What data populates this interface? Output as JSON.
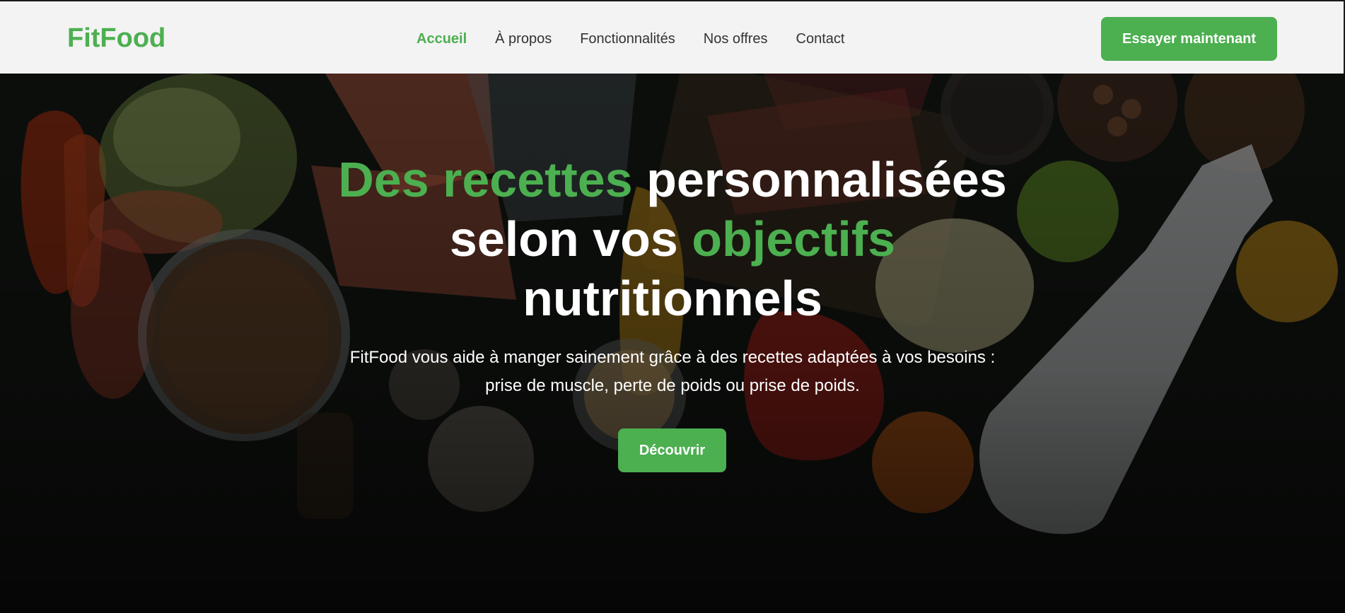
{
  "brand": {
    "name": "FitFood",
    "accent": "#4caf50"
  },
  "nav": {
    "items": [
      {
        "label": "Accueil",
        "active": true
      },
      {
        "label": "À propos",
        "active": false
      },
      {
        "label": "Fonctionnalités",
        "active": false
      },
      {
        "label": "Nos offres",
        "active": false
      },
      {
        "label": "Contact",
        "active": false
      }
    ]
  },
  "header": {
    "cta_label": "Essayer maintenant"
  },
  "hero": {
    "title": {
      "part1": "Des recettes",
      "part2": " personnalisées",
      "part3": "selon vos ",
      "part4": "objectifs",
      "part5": "nutritionnels"
    },
    "subtitle_line1": "FitFood vous aide à manger sainement grâce à des recettes adaptées à vos besoins :",
    "subtitle_line2": "prise de muscle, perte de poids ou prise de poids.",
    "button_label": "Découvrir",
    "background": "food-ingredients-photo"
  }
}
